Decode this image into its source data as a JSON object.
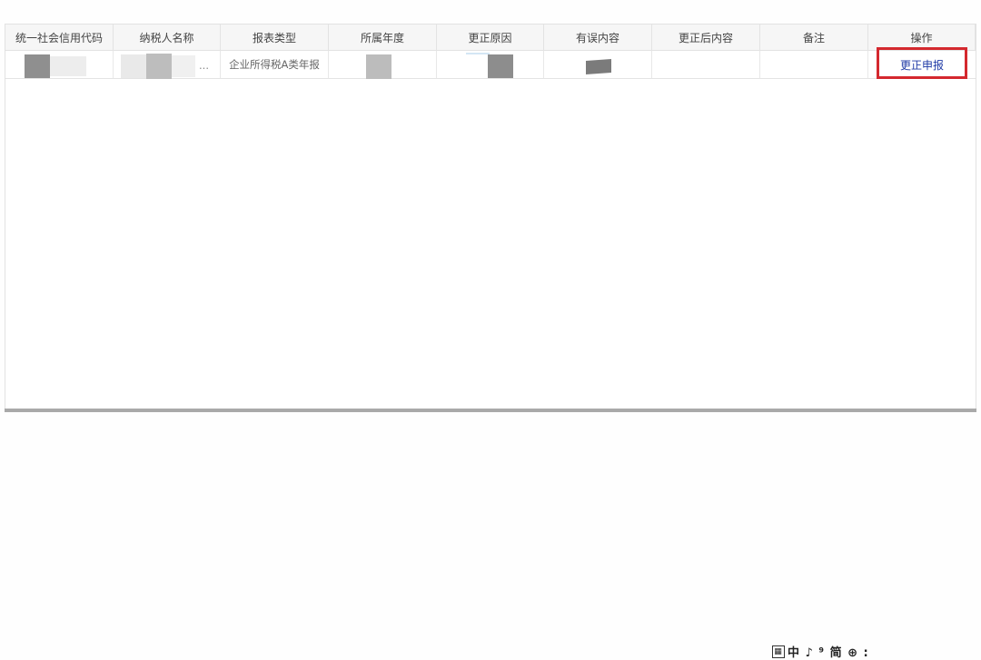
{
  "table": {
    "headers": [
      "统一社会信用代码",
      "纳税人名称",
      "报表类型",
      "所属年度",
      "更正原因",
      "有误内容",
      "更正后内容",
      "备注",
      "操作"
    ],
    "row": {
      "taxpayer_name_suffix": "...",
      "report_type": "企业所得税A类年报",
      "action_label": "更正申报"
    }
  },
  "colors": {
    "highlight": "#d4282e",
    "link": "#1f3aa6"
  },
  "watermark": {
    "icon": "grid-icon",
    "text": "中 ♪ ⁹ 简 ⊕ :"
  }
}
